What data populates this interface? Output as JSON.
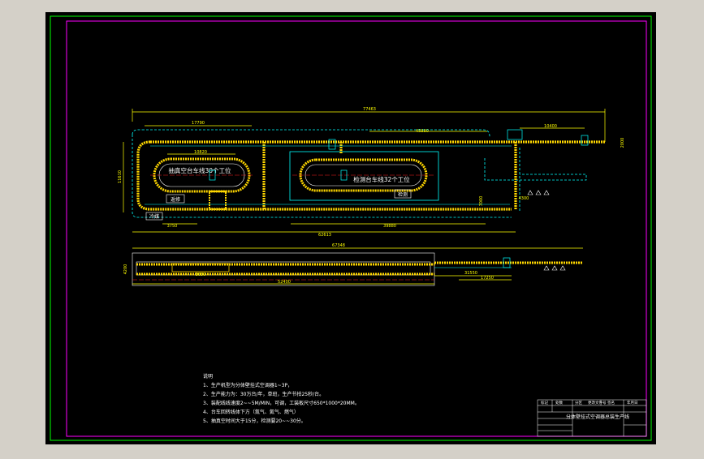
{
  "colors": {
    "background": "#d4d0c8",
    "paper": "#000000",
    "outer_border": "#00ff00",
    "inner_border": "#ff00ff",
    "track": "#ffd700",
    "dash": "#00ffff",
    "dim": "#ffff00",
    "text": "#ffffff",
    "center_line": "#ff2020"
  },
  "plan_view": {
    "dim_total_width": "77463",
    "dim_left_loop": "17790",
    "dim_left_oval": "10820",
    "dim_right_top": "10400",
    "dim_right_drop": "45880",
    "dim_left_vertical": "11610",
    "dim_bottom_short": "3750",
    "dim_bottom_mid": "39880",
    "dim_bottom_total": "62613",
    "dim_right_vertical": "7000",
    "dim_corner": "4300",
    "dim_side_small": "2000",
    "oval_left_label": "抽真空台车线30个工位",
    "oval_right_label": "检测台车线32个工位",
    "box_mid_label": "返修",
    "box_left_label": "检测",
    "box_bottom_label": "冷媒"
  },
  "elevation_view": {
    "dim_total": "67348",
    "dim_inner": "52400",
    "dim_mid": "3650",
    "dim_right_a": "31550",
    "dim_right_b": "17250",
    "dim_left_height": "4200"
  },
  "notes": {
    "title": "说明",
    "lines": [
      "1、生产机型为分体壁挂式空调器1~3P，",
      "2、生产能力为：30万台/年，单班，生产节拍25秒/台。",
      "3、装配线线速度2~~5M/MIN，可调，工装板尺寸650*1000*20MM。",
      "4、台车回转线体下方（氮气、氦气、燃气）",
      "5、抽真空时间大于15分，检测要20~~30分。"
    ]
  },
  "title_block": {
    "header_cells": [
      "标记",
      "处数",
      "分区",
      "更改文件号",
      "签名",
      "年月日"
    ],
    "drawing_title": "分体壁挂式空调器总装生产线"
  }
}
